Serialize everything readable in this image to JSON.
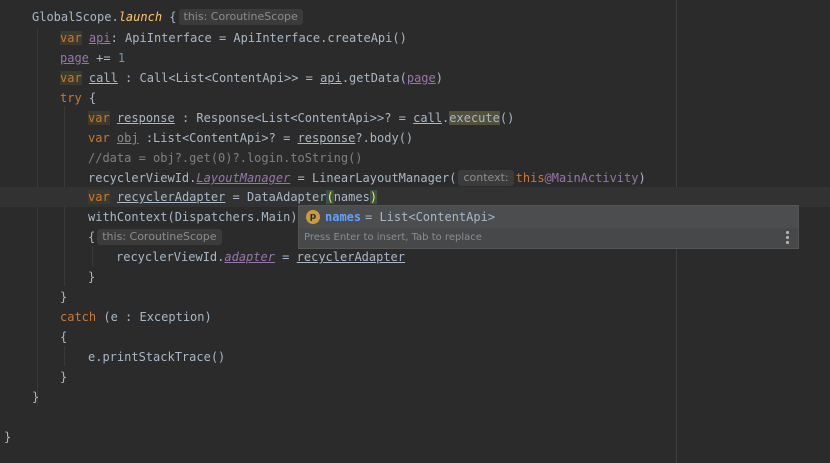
{
  "code": {
    "l1": {
      "a": "GlobalScope.",
      "b": "launch",
      "c": " {",
      "hint": "this: CoroutineScope"
    },
    "l2": {
      "kw": "var",
      "name": "api",
      "rest": ": ApiInterface = ApiInterface.createApi()"
    },
    "l3": {
      "name": "page",
      "op": " += ",
      "num": "1"
    },
    "l4": {
      "kw": "var",
      "name": "call",
      "a": " : Call<List<ContentApi>> = ",
      "api": "api",
      "b": ".getData(",
      "arg": "page",
      "c": ")"
    },
    "l5": {
      "kw": "try",
      "rest": " {"
    },
    "l6": {
      "kw": "var",
      "name": "response",
      "a": " : Response<List<ContentApi>>? = ",
      "call": "call",
      "dot": ".",
      "fn": "execute",
      "c": "()"
    },
    "l7": {
      "kw": "var",
      "name": "obj",
      "a": " :List<ContentApi>? = ",
      "ref": "response",
      "c": "?.body()"
    },
    "l8": {
      "comment": "//data = obj?.get(0)?.login.toString()"
    },
    "l9": {
      "a": "recyclerViewId.",
      "prop": "LayoutManager",
      "b": " = LinearLayoutManager(",
      "hint": "context:",
      "kw": "this",
      "label": "@MainActivity",
      "c": ")"
    },
    "l10": {
      "kw": "var",
      "name": "recyclerAdapter",
      "a": " = DataAdapter",
      "open": "(",
      "arg": "names",
      "close": ")"
    },
    "l11": {
      "a": "withContext(Dispatchers.Main)"
    },
    "l12": {
      "a": "{",
      "hint": "this: CoroutineScope"
    },
    "l13": {
      "a": "recyclerViewId.",
      "prop": "adapter",
      "b": " = ",
      "ref": "recyclerAdapter"
    },
    "l14": {
      "a": "}"
    },
    "l15": {
      "a": "}"
    },
    "l16": {
      "kw": "catch",
      "a": " (e : Exception)"
    },
    "l17": {
      "a": "{"
    },
    "l18": {
      "a": "e.printStackTrace()"
    },
    "l19": {
      "a": "}"
    },
    "l20": {
      "a": "}"
    },
    "l22": {
      "a": "}"
    }
  },
  "completion": {
    "icon_letter": "p",
    "item_name": "names",
    "item_type": " = List<ContentApi>",
    "footer": "Press Enter to insert, Tab to replace"
  },
  "colors": {
    "background": "#2b2b2b",
    "keyword": "#cc7832",
    "property": "#9876aa",
    "function": "#ffc66d",
    "number": "#6897bb",
    "comment": "#808080"
  }
}
